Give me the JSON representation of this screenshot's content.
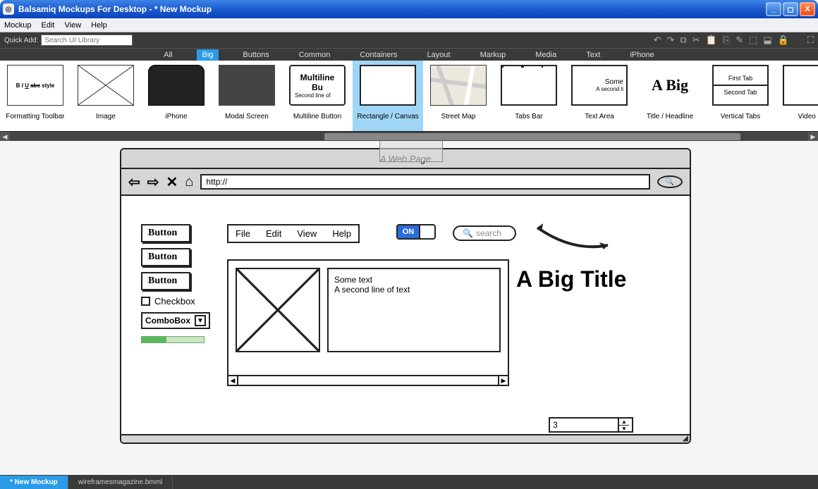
{
  "window": {
    "title": "Balsamiq Mockups For Desktop - * New Mockup"
  },
  "menubar": [
    "Mockup",
    "Edit",
    "View",
    "Help"
  ],
  "quickadd": {
    "label": "Quick Add:",
    "placeholder": "Search UI Library"
  },
  "categories": [
    "All",
    "Big",
    "Buttons",
    "Common",
    "Containers",
    "Layout",
    "Markup",
    "Media",
    "Text",
    "iPhone"
  ],
  "categories_active": "Big",
  "library": [
    {
      "label": "Formatting Toolbar",
      "thumb": "B I U"
    },
    {
      "label": "Image",
      "thumb": ""
    },
    {
      "label": "iPhone",
      "thumb": ""
    },
    {
      "label": "Modal Screen",
      "thumb": ""
    },
    {
      "label": "Multiline Button",
      "thumb": "Multiline Bu"
    },
    {
      "label": "Rectangle / Canvas",
      "thumb": ""
    },
    {
      "label": "Street Map",
      "thumb": ""
    },
    {
      "label": "Tabs Bar",
      "thumb": "One Two"
    },
    {
      "label": "Text Area",
      "thumb": "Some"
    },
    {
      "label": "Title / Headline",
      "thumb": "A Big"
    },
    {
      "label": "Vertical Tabs",
      "thumb": "First Tab"
    },
    {
      "label": "Video Pl",
      "thumb": ""
    }
  ],
  "lib_multiline_sub": "Second line of",
  "lib_textarea_sub": "A second li",
  "lib_vtab2": "Second Tab",
  "mockup": {
    "browser_title": "A Web Page",
    "url_prefix": "http://",
    "buttons": [
      "Button",
      "Button",
      "Button"
    ],
    "checkbox_label": "Checkbox",
    "combo_label": "ComboBox",
    "menubar": [
      "File",
      "Edit",
      "View",
      "Help"
    ],
    "toggle_on": "ON",
    "search_placeholder": "search",
    "big_title": "A Big Title",
    "textarea_line1": "Some text",
    "textarea_line2": "A second line of text",
    "stepper_value": "3"
  },
  "bottom_tabs": [
    {
      "label": "* New Mockup",
      "active": true
    },
    {
      "label": "wireframesmagazine.bmml",
      "active": false
    }
  ]
}
